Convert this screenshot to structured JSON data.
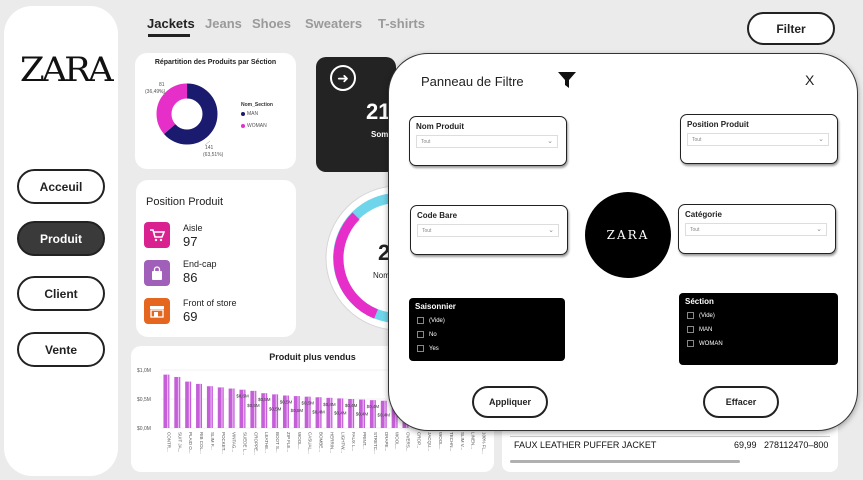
{
  "brand": "ZARA",
  "nav": [
    {
      "label": "Acceuil",
      "active": false
    },
    {
      "label": "Produit",
      "active": true
    },
    {
      "label": "Client",
      "active": false
    },
    {
      "label": "Vente",
      "active": false
    }
  ],
  "tabs": [
    {
      "label": "Jackets",
      "active": true
    },
    {
      "label": "Jeans",
      "active": false
    },
    {
      "label": "Shoes",
      "active": false
    },
    {
      "label": "Sweaters",
      "active": false
    },
    {
      "label": "T-shirts",
      "active": false
    }
  ],
  "filter_button": "Filter",
  "repartition": {
    "title": "Répartition des Produits par Séction",
    "legend_title": "Nom_Section",
    "legend": [
      "MAN",
      "WOMAN"
    ],
    "label_woman": "81",
    "label_woman_pct": "(36,49%)",
    "label_man": "141",
    "label_man_pct": "(63,51%)",
    "chart_data": {
      "type": "pie",
      "categories": [
        "MAN",
        "WOMAN"
      ],
      "values": [
        141,
        81
      ],
      "colors": [
        "#1a1a6e",
        "#e62ec9"
      ]
    }
  },
  "position": {
    "title": "Position Produit",
    "items": [
      {
        "label": "Aisle",
        "value": "97",
        "color": "#d9218f",
        "icon": "shopping-cart-icon"
      },
      {
        "label": "End-cap",
        "value": "86",
        "color": "#a05fb8",
        "icon": "shopping-bag-icon"
      },
      {
        "label": "Front of store",
        "value": "69",
        "color": "#e5671f",
        "icon": "storefront-icon"
      }
    ]
  },
  "dark_card": {
    "number": "21",
    "label": "Som"
  },
  "gauge": {
    "number": "2",
    "label": "Nom"
  },
  "bar_chart": {
    "title": "Produit plus vendus",
    "y_ticks": [
      "$1,0M",
      "$0,5M",
      "$0,0M"
    ],
    "data_labels": [
      "$0,6M",
      "$0,5M",
      "$0,5M",
      "$0,5M",
      "$0,5M",
      "$0,5M",
      "$0,5M",
      "$0,4M",
      "$0,4M",
      "$0,4M",
      "$0,4M",
      "$0,4M",
      "$0,4M",
      "$0,4M"
    ],
    "x_labels": [
      "CONTR...",
      "SUIT JA...",
      "PLAID O...",
      "RIB COL...",
      "SLIM F...",
      "POCKET...",
      "VINTAG...",
      "SUEDE L...",
      "CROPPE...",
      "LEATHE...",
      "BOOT S...",
      "ZIP FLE...",
      "WOOL...",
      "CASUAL...",
      "BOMBE...",
      "HERRIN...",
      "LIGHTW...",
      "FAUX L...",
      "PRINT...",
      "STRETC...",
      "DRAPE...",
      "WOOL...",
      "OVERS...",
      "CROP...",
      "JACQU...",
      "WOOL...",
      "TECHN...",
      "SLIM V...",
      "LINEN...",
      "100% FL..."
    ],
    "chart_data": {
      "type": "bar",
      "ylim": [
        0,
        1.0
      ],
      "values": [
        0.92,
        0.88,
        0.8,
        0.76,
        0.72,
        0.7,
        0.68,
        0.66,
        0.64,
        0.6,
        0.58,
        0.56,
        0.55,
        0.54,
        0.53,
        0.52,
        0.51,
        0.5,
        0.49,
        0.48,
        0.47,
        0.46,
        0.45,
        0.44,
        0.43,
        0.42,
        0.41,
        0.4,
        0.39,
        0.38
      ]
    }
  },
  "table": {
    "name": "FAUX LEATHER PUFFER JACKET",
    "price": "69,99",
    "code": "278112470–800"
  },
  "panel": {
    "title": "Panneau de Filtre",
    "close": "X",
    "slicers": [
      {
        "title": "Nom Produit",
        "value": "Tout"
      },
      {
        "title": "Position Produit",
        "value": "Tout"
      },
      {
        "title": "Code Bare",
        "value": "Tout"
      },
      {
        "title": "Catégorie",
        "value": "Tout"
      }
    ],
    "saisonnier": {
      "title": "Saisonnier",
      "options": [
        "(Vide)",
        "No",
        "Yes"
      ]
    },
    "section": {
      "title": "Séction",
      "options": [
        "(Vide)",
        "MAN",
        "WOMAN"
      ]
    },
    "logo": "ZARA",
    "apply": "Appliquer",
    "clear": "Effacer"
  }
}
